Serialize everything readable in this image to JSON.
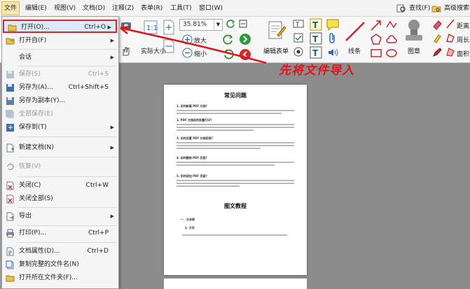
{
  "menubar": {
    "items": [
      "文件",
      "编辑(E)",
      "视图(V)",
      "文档(D)",
      "注释(Z)",
      "表单(R)",
      "工具(T)",
      "窗口(W)"
    ],
    "find_label": "查找(F)",
    "advanced_search_label": "高级搜索"
  },
  "ribbon": {
    "zoom_value": "35.81%",
    "zoom_in": "放大",
    "zoom_out": "缩小",
    "actual_size": "实际大小",
    "edit_form": "编辑表单",
    "line": "线条",
    "stamp": "图章",
    "distance": "距离",
    "perimeter": "周长",
    "area": "面积"
  },
  "file_menu": {
    "open": {
      "label": "打开(O)...",
      "shortcut": "Ctrl+O"
    },
    "open_from": {
      "label": "打开自(F)"
    },
    "session": {
      "label": "会话"
    },
    "save": {
      "label": "保存(S)",
      "shortcut": "Ctrl+S"
    },
    "save_as": {
      "label": "另存为(A)...",
      "shortcut": "Ctrl+Shift+S"
    },
    "save_copy": {
      "label": "另存为副本(Y)..."
    },
    "save_all": {
      "label": "全部保存(E)"
    },
    "save_to": {
      "label": "保存到(T)"
    },
    "new_doc": {
      "label": "新建文档(N)"
    },
    "revert": {
      "label": "恢复(V)"
    },
    "close": {
      "label": "关闭(C)",
      "shortcut": "Ctrl+W"
    },
    "close_all": {
      "label": "关闭全部(S)"
    },
    "export": {
      "label": "导出"
    },
    "print": {
      "label": "打印(P)...",
      "shortcut": "Ctrl+P"
    },
    "properties": {
      "label": "文档属性(D)...",
      "shortcut": "Ctrl+D"
    },
    "copy_path": {
      "label": "复制完整的文件名(N)"
    },
    "open_folder": {
      "label": "打开所在文件夹(F)..."
    }
  },
  "annotation": {
    "text": "先将文件导入"
  },
  "document": {
    "title1": "常见问题",
    "title2": "图文教程",
    "q1": "1. 如何新建 PDF 文档?",
    "q2": "2. PDF 文档如何批量打印?",
    "q3": "3. 如何设置 PDF 文档权限?",
    "q4": "4. 如何删除 PDF 页面?",
    "q5": "5. 如何添加 PDF 页面?",
    "s1": "一、文本框",
    "s2": "1. 文字"
  },
  "colors": {
    "accent_red": "#e0141b",
    "highlight": "#fbe7a8",
    "menu_hover": "#dbe9f8"
  }
}
